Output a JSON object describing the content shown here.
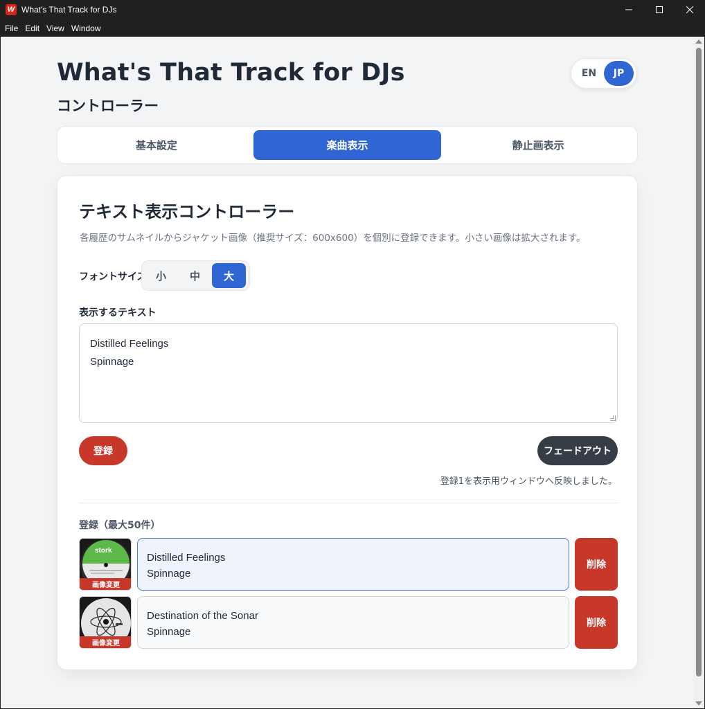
{
  "window": {
    "title": "What's That Track for DJs",
    "app_icon_letter": "W",
    "controls": {
      "minimize": "minimize-icon",
      "maximize": "maximize-icon",
      "close": "close-icon"
    }
  },
  "menu": [
    "File",
    "Edit",
    "View",
    "Window"
  ],
  "header": {
    "title": "What's That Track for DJs",
    "subtitle": "コントローラー"
  },
  "lang": {
    "options": [
      "EN",
      "JP"
    ],
    "selected": "JP"
  },
  "tabs": [
    {
      "label": "基本設定",
      "active": false
    },
    {
      "label": "楽曲表示",
      "active": true
    },
    {
      "label": "静止画表示",
      "active": false
    }
  ],
  "card": {
    "title": "テキスト表示コントローラー",
    "description": "各履歴のサムネイルからジャケット画像（推奨サイズ：600x600）を個別に登録できます。小さい画像は拡大されます。",
    "font_size": {
      "label": "フォントサイズ",
      "options": [
        "小",
        "中",
        "大"
      ],
      "selected": "大"
    },
    "text": {
      "label": "表示するテキスト",
      "lines": [
        "Distilled Feelings",
        "Spinnage"
      ]
    },
    "register_label": "登録",
    "fadeout_label": "フェードアウト",
    "status": "登録1を表示用ウィンドウへ反映しました。"
  },
  "history": {
    "header": "登録（最大50件）",
    "entries": [
      {
        "line1": "Distilled Feelings",
        "line2": "Spinnage",
        "selected": true,
        "thumb_badge": "画像変更",
        "delete_label": "削除",
        "thumb_icon": "vinyl-record-green-icon",
        "thumb_label": "stork"
      },
      {
        "line1": "Destination of the Sonar",
        "line2": "Spinnage",
        "selected": false,
        "thumb_badge": "画像変更",
        "delete_label": "削除",
        "thumb_icon": "vinyl-record-atom-icon"
      }
    ]
  },
  "colors": {
    "accent": "#3066d4",
    "danger": "#c7372a",
    "dark": "#373d47",
    "background": "#f3f4f6"
  }
}
